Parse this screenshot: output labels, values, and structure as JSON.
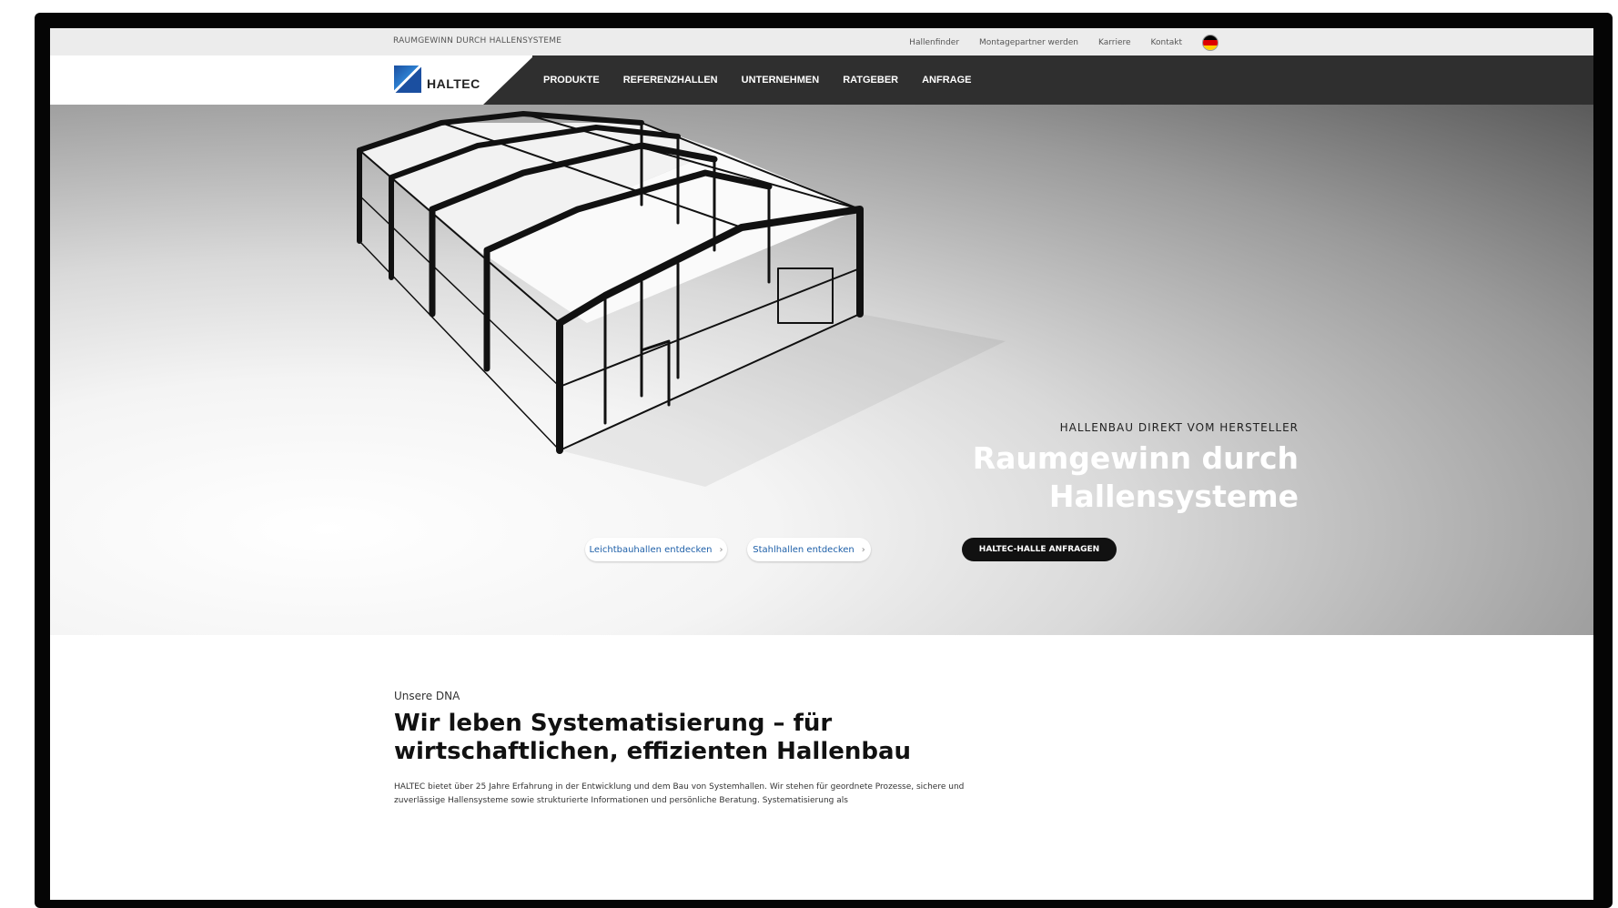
{
  "topbar": {
    "tagline": "RAUMGEWINN DURCH HALLENSYSTEME",
    "links": [
      "Hallenfinder",
      "Montagepartner werden",
      "Karriere",
      "Kontakt"
    ],
    "language_icon": "germany-flag-icon"
  },
  "header": {
    "logo_text": "HALTEC",
    "logo_icon": "haltec-logo-mark",
    "nav": [
      "PRODUKTE",
      "REFERENZHALLEN",
      "UNTERNEHMEN",
      "RATGEBER",
      "ANFRAGE"
    ]
  },
  "hero": {
    "eyebrow": "HALLENBAU DIREKT VOM HERSTELLER",
    "title": "Raumgewinn durch Hallensysteme",
    "buttons": {
      "leichtbau": "Leichtbauhallen entdecken",
      "stahl": "Stahlhallen entdecken",
      "anfrage": "HALTEC-HALLE ANFRAGEN"
    },
    "chevron": "›"
  },
  "intro": {
    "eyebrow": "Unsere DNA",
    "title": "Wir leben Systematisierung – für wirtschaftlichen, effizienten Hallenbau",
    "text": "HALTEC bietet über 25 Jahre Erfahrung in der Entwicklung und dem Bau von Systemhallen. Wir stehen für geordnete Prozesse, sichere und zuverlässige Hallensysteme sowie strukturierte Informationen und persönliche Beratung. Systematisierung als"
  },
  "colors": {
    "nav_dark": "#2f2f2f",
    "link_blue": "#1d5fa8",
    "cta_dark": "#111111"
  }
}
